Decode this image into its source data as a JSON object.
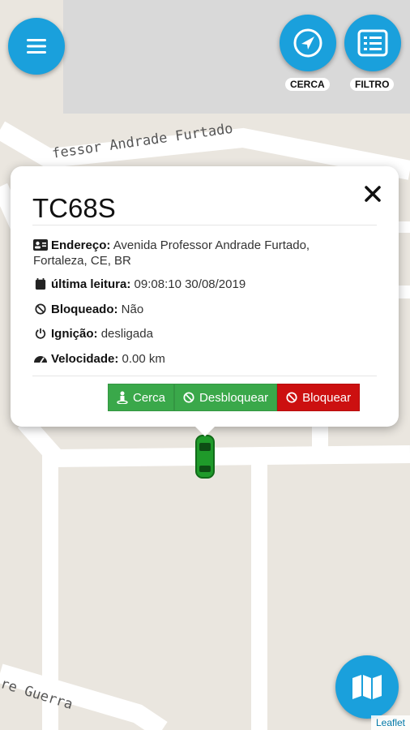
{
  "header": {
    "menu_icon": "hamburger-menu-icon",
    "cerca_label": "CERCA",
    "filtro_label": "FILTRO"
  },
  "map": {
    "streets": [
      "fessor Andrade Furtado",
      "re Guerra"
    ],
    "attribution": "Leaflet"
  },
  "popup": {
    "title": "TC68S",
    "address_label": "Endereço:",
    "address_value": "Avenida Professor Andrade Furtado,",
    "address_value2": "Fortaleza, CE, BR",
    "last_read_label": "última leitura:",
    "last_read_value": "09:08:10 30/08/2019",
    "blocked_label": "Bloqueado:",
    "blocked_value": "Não",
    "ignition_label": "Ignição:",
    "ignition_value": "desligada",
    "speed_label": "Velocidade:",
    "speed_value": "0.00 km",
    "btn_cerca": "Cerca",
    "btn_unblock": "Desbloquear",
    "btn_block": "Bloquear"
  },
  "colors": {
    "accent": "#1aa0dc",
    "green": "#3aa84a",
    "red": "#cc1010"
  }
}
